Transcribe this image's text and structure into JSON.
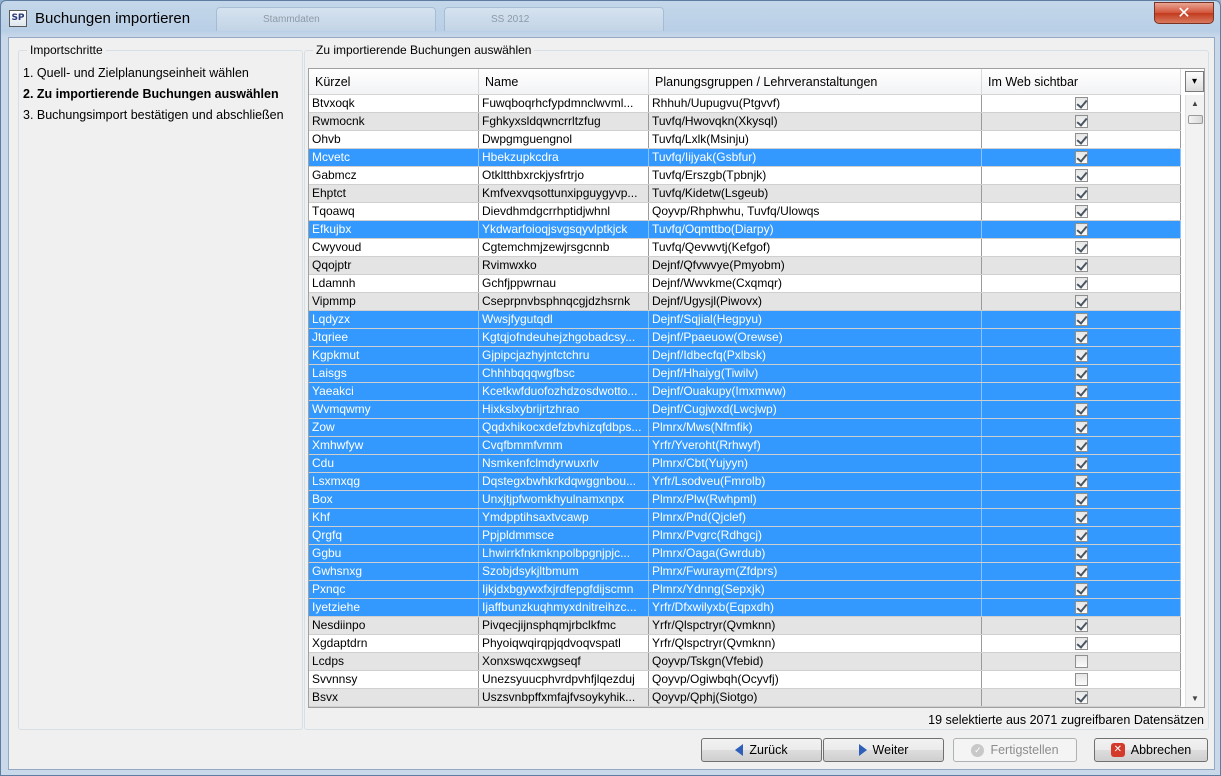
{
  "window": {
    "title": "Buchungen importieren",
    "app_icon": "SP",
    "close_glyph": "✕"
  },
  "background_tabs": [
    "Stammdaten",
    "SS 2012"
  ],
  "steps_panel": {
    "legend": "Importschritte",
    "items": [
      {
        "label": "1. Quell- und Zielplanungseinheit wählen",
        "active": false
      },
      {
        "label": "2. Zu importierende Buchungen auswählen",
        "active": true
      },
      {
        "label": "3. Buchungsimport bestätigen und abschließen",
        "active": false
      }
    ]
  },
  "main_panel": {
    "legend": "Zu importierende Buchungen auswählen"
  },
  "grid": {
    "columns": [
      "Kürzel",
      "Name",
      "Planungsgruppen / Lehrveranstaltungen",
      "Im Web sichtbar"
    ],
    "column_picker_icon": "column-chooser-icon",
    "rows": [
      {
        "kuerzel": "Btvxoqk",
        "name": "Fuwqboqrhcfypdmnclwvml...",
        "gruppe": "Rhhuh/Uupugvu(Ptgvvf)",
        "web": true,
        "selected": false
      },
      {
        "kuerzel": "Rwmocnk",
        "name": "Fghkyxsldqwncrrltzfug",
        "gruppe": "Tuvfq/Hwovqkn(Xkysql)",
        "web": true,
        "selected": false
      },
      {
        "kuerzel": "Ohvb",
        "name": "Dwpgmguengnol",
        "gruppe": "Tuvfq/Lxlk(Msinju)",
        "web": true,
        "selected": false
      },
      {
        "kuerzel": "Mcvetc",
        "name": "Hbekzupkcdra",
        "gruppe": "Tuvfq/Iijyak(Gsbfur)",
        "web": true,
        "selected": true
      },
      {
        "kuerzel": "Gabmcz",
        "name": "Otkltthbxrckjysfrtrjo",
        "gruppe": "Tuvfq/Erszgb(Tpbnjk)",
        "web": true,
        "selected": false
      },
      {
        "kuerzel": "Ehptct",
        "name": "Kmfvexvqsottunxipguygyvp...",
        "gruppe": "Tuvfq/Kidetw(Lsgeub)",
        "web": true,
        "selected": false
      },
      {
        "kuerzel": "Tqoawq",
        "name": "Dievdhmdgcrrhptidjwhnl",
        "gruppe": "Qoyvp/Rhphwhu, Tuvfq/Ulowqs",
        "web": true,
        "selected": false
      },
      {
        "kuerzel": "Efkujbx",
        "name": "Ykdwarfoioqjsvgsqyvlptkjck",
        "gruppe": "Tuvfq/Oqmttbo(Diarpy)",
        "web": true,
        "selected": true
      },
      {
        "kuerzel": "Cwyvoud",
        "name": "Cgtemchmjzewjrsgcnnb",
        "gruppe": "Tuvfq/Qevwvtj(Kefgof)",
        "web": true,
        "selected": false
      },
      {
        "kuerzel": "Qqojptr",
        "name": "Rvimwxko",
        "gruppe": "Dejnf/Qfvwvye(Pmyobm)",
        "web": true,
        "selected": false
      },
      {
        "kuerzel": "Ldamnh",
        "name": "Gchfjppwrnau",
        "gruppe": "Dejnf/Wwvkme(Cxqmqr)",
        "web": true,
        "selected": false
      },
      {
        "kuerzel": "Vipmmp",
        "name": "Cseprpnvbsphnqcgjdzhsrnk",
        "gruppe": "Dejnf/Ugysjl(Piwovx)",
        "web": true,
        "selected": false
      },
      {
        "kuerzel": "Lqdyzx",
        "name": "Wwsjfygutqdl",
        "gruppe": "Dejnf/Sqjial(Hegpyu)",
        "web": true,
        "selected": true
      },
      {
        "kuerzel": "Jtqriee",
        "name": "Kgtqjofndeuhejzhgobadcsy...",
        "gruppe": "Dejnf/Ppaeuow(Orewse)",
        "web": true,
        "selected": true
      },
      {
        "kuerzel": "Kgpkmut",
        "name": "Gjpipcjazhyjntctchru",
        "gruppe": "Dejnf/Idbecfq(Pxlbsk)",
        "web": true,
        "selected": true
      },
      {
        "kuerzel": "Laisgs",
        "name": "Chhhbqqqwgfbsc",
        "gruppe": "Dejnf/Hhaiyg(Tiwilv)",
        "web": true,
        "selected": true
      },
      {
        "kuerzel": "Yaeakci",
        "name": "Kcetkwfduofozhdzosdwotto...",
        "gruppe": "Dejnf/Ouakupy(Imxmww)",
        "web": true,
        "selected": true
      },
      {
        "kuerzel": "Wvmqwmy",
        "name": "Hixkslxybrijrtzhrao",
        "gruppe": "Dejnf/Cugjwxd(Lwcjwp)",
        "web": true,
        "selected": true
      },
      {
        "kuerzel": "Zow",
        "name": "Qqdxhikocxdefzbvhizqfdbps...",
        "gruppe": "Plmrx/Mws(Nfmfik)",
        "web": true,
        "selected": true
      },
      {
        "kuerzel": "Xmhwfyw",
        "name": "Cvqfbmmfvmm",
        "gruppe": "Yrfr/Yveroht(Rrhwyf)",
        "web": true,
        "selected": true
      },
      {
        "kuerzel": "Cdu",
        "name": "Nsmkenfclmdyrwuxrlv",
        "gruppe": "Plmrx/Cbt(Yujyyn)",
        "web": true,
        "selected": true
      },
      {
        "kuerzel": "Lsxmxqg",
        "name": "Dqstegxbwhkrkdqwggnbou...",
        "gruppe": "Yrfr/Lsodveu(Fmrolb)",
        "web": true,
        "selected": true
      },
      {
        "kuerzel": "Box",
        "name": "Unxjtjpfwomkhyulnamxnpx",
        "gruppe": "Plmrx/Plw(Rwhpml)",
        "web": true,
        "selected": true
      },
      {
        "kuerzel": "Khf",
        "name": "Ymdpptihsaxtvcawp",
        "gruppe": "Plmrx/Pnd(Qjclef)",
        "web": true,
        "selected": true
      },
      {
        "kuerzel": "Qrgfq",
        "name": "Ppjpldmmsce",
        "gruppe": "Plmrx/Pvgrc(Rdhgcj)",
        "web": true,
        "selected": true
      },
      {
        "kuerzel": "Ggbu",
        "name": "Lhwirrkfnkmknpolbpgnjpjc...",
        "gruppe": "Plmrx/Oaga(Gwrdub)",
        "web": true,
        "selected": true
      },
      {
        "kuerzel": "Gwhsnxg",
        "name": "Szobjdsykjltbmum",
        "gruppe": "Plmrx/Fwuraym(Zfdprs)",
        "web": true,
        "selected": true
      },
      {
        "kuerzel": "Pxnqc",
        "name": "Ijkjdxbgywxfxjrdfepgfdijscmn",
        "gruppe": "Plmrx/Ydnng(Sepxjk)",
        "web": true,
        "selected": true
      },
      {
        "kuerzel": "Iyetziehe",
        "name": "Ijaffbunzkuqhmyxdnitreihzc...",
        "gruppe": "Yrfr/Dfxwilyxb(Eqpxdh)",
        "web": true,
        "selected": true
      },
      {
        "kuerzel": "Nesdiinpo",
        "name": "Pivqecjijnsphqmjrbclkfmc",
        "gruppe": "Yrfr/Qlspctryr(Qvmknn)",
        "web": true,
        "selected": false
      },
      {
        "kuerzel": "Xgdaptdrn",
        "name": "Phyoiqwqirqpjqdvoqvspatl",
        "gruppe": "Yrfr/Qlspctryr(Qvmknn)",
        "web": true,
        "selected": false
      },
      {
        "kuerzel": "Lcdps",
        "name": "Xonxswqcxwgseqf",
        "gruppe": "Qoyvp/Tskgn(Vfebid)",
        "web": false,
        "selected": false
      },
      {
        "kuerzel": "Svvnnsy",
        "name": "Unezsyuucphvrdpvhfjlqezduj",
        "gruppe": "Qoyvp/Ogiwbqh(Ocyvfj)",
        "web": false,
        "selected": false
      },
      {
        "kuerzel": "Bsvx",
        "name": "Uszsvnbpffxmfajfvsoykyhik...",
        "gruppe": "Qoyvp/Qphj(Siotgo)",
        "web": true,
        "selected": false
      }
    ]
  },
  "status": "19 selektierte aus 2071 zugreifbaren Datensätzen",
  "buttons": {
    "back": "Zurück",
    "next": "Weiter",
    "finish": "Fertigstellen",
    "cancel": "Abbrechen"
  },
  "colors": {
    "selection": "#3399ff",
    "alt_row": "#e4e4e4",
    "cancel_icon": "#d43a2a"
  }
}
